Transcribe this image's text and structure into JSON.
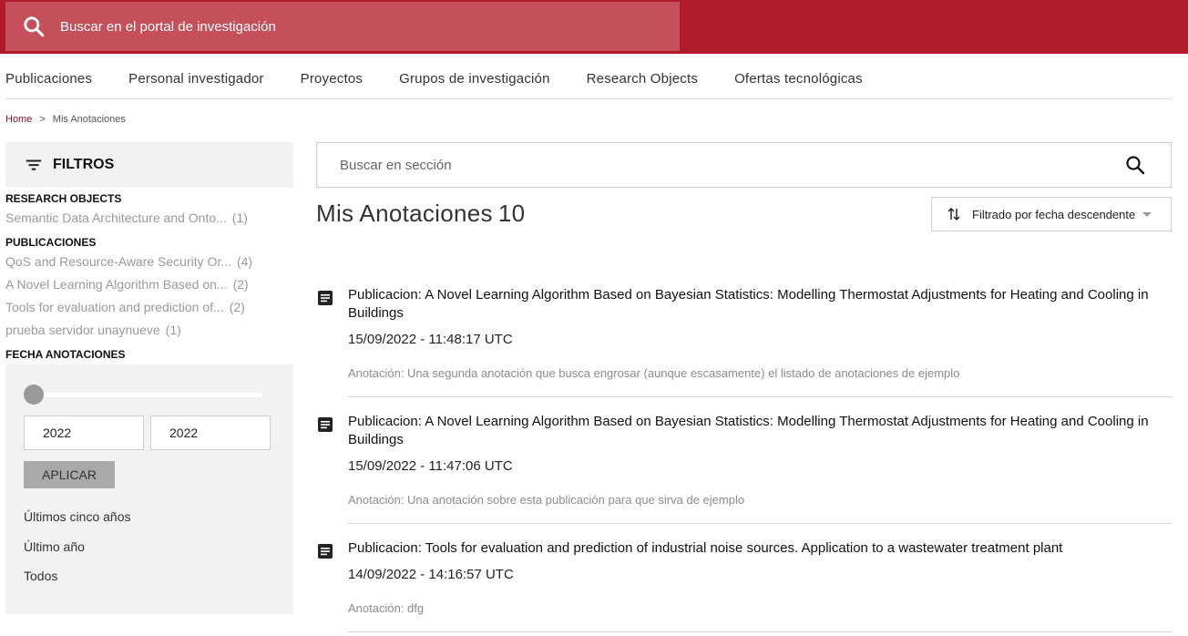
{
  "top_search": {
    "placeholder": "Buscar en el portal de investigación",
    "icon": "search-icon"
  },
  "nav": [
    "Publicaciones",
    "Personal investigador",
    "Proyectos",
    "Grupos de investigación",
    "Research Objects",
    "Ofertas tecnológicas"
  ],
  "breadcrumb": {
    "home": "Home",
    "separator": ">",
    "current": "Mis Anotaciones"
  },
  "filters": {
    "title": "FILTROS",
    "groups": [
      {
        "title": "RESEARCH OBJECTS",
        "items": [
          {
            "label": "Semantic Data Architecture and Onto...",
            "count": "(1)"
          }
        ]
      },
      {
        "title": "PUBLICACIONES",
        "items": [
          {
            "label": "QoS and Resource-Aware Security Or...",
            "count": "(4)"
          },
          {
            "label": "A Novel Learning Algorithm Based on...",
            "count": "(2)"
          },
          {
            "label": "Tools for evaluation and prediction of...",
            "count": "(2)"
          },
          {
            "label": "prueba servidor unaynueve",
            "count": "(1)"
          }
        ]
      },
      {
        "title": "FECHA ANOTACIONES",
        "items": []
      }
    ],
    "date": {
      "from": "2022",
      "to": "2022",
      "apply": "APLICAR",
      "quick": [
        "Últimos cinco años",
        "Último año",
        "Todos"
      ]
    }
  },
  "section_search": {
    "placeholder": "Buscar en sección"
  },
  "page": {
    "title": "Mis Anotaciones",
    "count": "10"
  },
  "sort": {
    "label": "Filtrado por fecha descendente"
  },
  "annotations": [
    {
      "title": "Publicacion: A Novel Learning Algorithm Based on Bayesian Statistics: Modelling Thermostat Adjustments for Heating and Cooling in Buildings",
      "date": "15/09/2022 - 11:48:17 UTC",
      "note": "Anotación: Una segunda anotación que busca engrosar (aunque escasamente) el listado de anotaciones de ejemplo"
    },
    {
      "title": "Publicacion: A Novel Learning Algorithm Based on Bayesian Statistics: Modelling Thermostat Adjustments for Heating and Cooling in Buildings",
      "date": "15/09/2022 - 11:47:06 UTC",
      "note": "Anotación: Una anotación sobre esta publicación para que sirva de ejemplo"
    },
    {
      "title": "Publicacion: Tools for evaluation and prediction of industrial noise sources. Application to a wastewater treatment plant",
      "date": "14/09/2022 - 14:16:57 UTC",
      "note": "Anotación: dfg"
    }
  ],
  "colors": {
    "brand": "#b21b2c",
    "brand_light": "#c5505c"
  }
}
